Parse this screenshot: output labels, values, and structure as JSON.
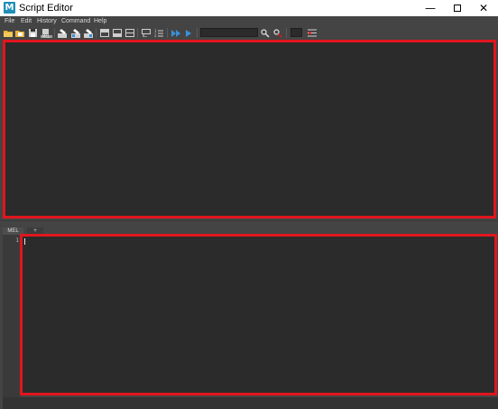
{
  "window": {
    "title": "Script Editor",
    "app_icon_letter": "M",
    "controls": {
      "minimize": "—",
      "maximize": "",
      "close": "✕"
    }
  },
  "menu": {
    "items": [
      {
        "label": "File"
      },
      {
        "label": "Edit"
      },
      {
        "label": "History"
      },
      {
        "label": "Command"
      },
      {
        "label": "Help"
      }
    ]
  },
  "toolbar": {
    "icons": [
      "open-script-icon",
      "source-script-icon",
      "save-script-icon",
      "save-to-shelf-icon",
      "clear-history-icon",
      "clear-input-icon",
      "clear-all-icon",
      "show-history-only-icon",
      "show-input-only-icon",
      "show-both-icon",
      "echo-all-commands-icon",
      "show-line-numbers-icon",
      "execute-all-icon",
      "execute-icon",
      "search-field",
      "search-icon",
      "next-result-icon",
      "dark-box",
      "clear-search-icon"
    ]
  },
  "tabs": {
    "items": [
      {
        "label": "MEL"
      },
      {
        "label": "+"
      }
    ]
  },
  "editor": {
    "line_numbers": [
      "1"
    ]
  },
  "colors": {
    "panel_bg": "#2b2b2b",
    "chrome_bg": "#444444",
    "highlight_border": "#e0161e",
    "execute_blue": "#3a8fd8"
  }
}
